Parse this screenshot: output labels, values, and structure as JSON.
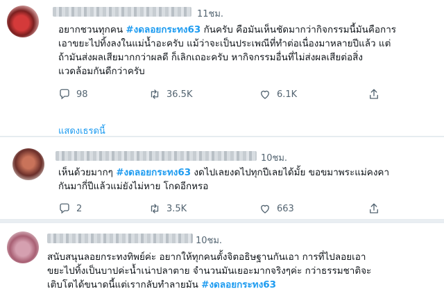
{
  "tweets": [
    {
      "time": "11ชม.",
      "lines": [
        {
          "pre": "อยากชวนทุกคน ",
          "tag": "#งดลอยกระทง63",
          "post": " กันครับ คือมันเห็นชัดมากว่ากิจกรรมนี้มันคือการ"
        },
        {
          "text": "เอาขยะไปทิ้งลงในแม่น้ำอะครับ แม้ว่าจะเป็นประเพณีที่ทำต่อเนื่องมาหลายปีแล้ว แต่"
        },
        {
          "text": "ถ้ามันส่งผลเสียมากกว่าผลดี ก็เลิกเถอะครับ หากิจกรรมอื่นที่ไม่ส่งผลเสียต่อสิ่ง"
        },
        {
          "text": "แวดล้อมกันดีกว่าครับ"
        }
      ],
      "replies": "98",
      "retweets": "36.5K",
      "likes": "6.1K",
      "show_thread": "แสดงเธรดนี้"
    },
    {
      "time": "10ชม.",
      "lines": [
        {
          "pre": "เห็นด้วยมากๆ ",
          "tag": "#งดลอยกระทง63",
          "post": " งดไปเลยงดไปทุกปีเลยได้มั้ย ขอขมาพระแม่คงคา"
        },
        {
          "text": "กันมากี่ปีแล้วแม่ยังไม่หาย โกดอีกหรอ"
        }
      ],
      "replies": "2",
      "retweets": "3.5K",
      "likes": "663"
    },
    {
      "time": "10ชม.",
      "lines": [
        {
          "text": "สนับสนุนลอยกระทงทิพย์ค่ะ อยากให้ทุกคนตั้งจิตอธิษฐานกันเอา การที่ไปลอยเอา"
        },
        {
          "text": "ขยะไปทิ้งเป็นบาปค่ะน้ำเน่าปลาตาย จำนวนมันเยอะมากจริงๆค่ะ กว่าธรรมชาติจะ"
        },
        {
          "pre": "เติบโตได้ขนาดนี้แต่เรากลับทำลายมัน ",
          "tag": "#งดลอยกระทง63",
          "post": ""
        }
      ]
    }
  ],
  "icons": {
    "reply": "reply-icon",
    "retweet": "retweet-icon",
    "like": "heart-icon",
    "share": "share-icon"
  },
  "colors": {
    "accent": "#1d9bf0",
    "text": "#0f1419",
    "muted": "#536471",
    "divider": "#e6ecf0"
  }
}
